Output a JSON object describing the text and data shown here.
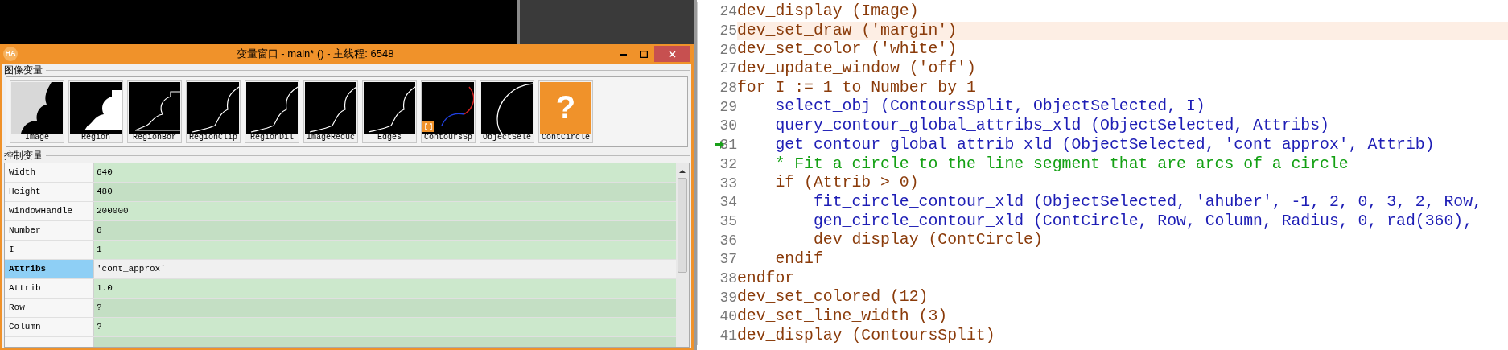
{
  "variable_window": {
    "logo": "HA",
    "title": "变量窗口 - main* () - 主线程: 6548",
    "iconic_section": "图像变量",
    "iconic_vars": [
      {
        "name": "Image",
        "kind": "gray",
        "tuple": false
      },
      {
        "name": "Region",
        "kind": "region",
        "tuple": false
      },
      {
        "name": "RegionBor",
        "kind": "border",
        "tuple": false
      },
      {
        "name": "RegionClip",
        "kind": "contour",
        "tuple": false
      },
      {
        "name": "RegionDil",
        "kind": "contour",
        "tuple": false
      },
      {
        "name": "ImageReduc",
        "kind": "contour",
        "tuple": false
      },
      {
        "name": "Edges",
        "kind": "contour",
        "tuple": false
      },
      {
        "name": "ContoursSp",
        "kind": "split",
        "tuple": true
      },
      {
        "name": "ObjectSele",
        "kind": "circle",
        "tuple": false
      },
      {
        "name": "ContCircle",
        "kind": "undefined",
        "glyph": "?",
        "tuple": false
      }
    ],
    "control_section": "控制变量",
    "control_vars": [
      {
        "name": "Width",
        "value": "640",
        "selected": false
      },
      {
        "name": "Height",
        "value": "480",
        "selected": false
      },
      {
        "name": "WindowHandle",
        "value": "200000",
        "selected": false
      },
      {
        "name": "Number",
        "value": "6",
        "selected": false
      },
      {
        "name": "I",
        "value": "1",
        "selected": false
      },
      {
        "name": "Attribs",
        "value": "'cont_approx'",
        "selected": true
      },
      {
        "name": "Attrib",
        "value": "1.0",
        "selected": false
      },
      {
        "name": "Row",
        "value": "?",
        "selected": false
      },
      {
        "name": "Column",
        "value": "?",
        "selected": false
      }
    ]
  },
  "editor": {
    "lines": [
      {
        "number": "24",
        "text": "dev_display (Image)",
        "kind": "control",
        "highlighted": false,
        "current": false
      },
      {
        "number": "25",
        "text": "dev_set_draw ('margin')",
        "kind": "control",
        "highlighted": true,
        "current": false
      },
      {
        "number": "26",
        "text": "dev_set_color ('white')",
        "kind": "control",
        "highlighted": false,
        "current": false
      },
      {
        "number": "27",
        "text": "dev_update_window ('off')",
        "kind": "control",
        "highlighted": false,
        "current": false
      },
      {
        "number": "28",
        "text": "for I := 1 to Number by 1",
        "kind": "control",
        "highlighted": false,
        "current": false
      },
      {
        "number": "29",
        "text": "    select_obj (ContoursSplit, ObjectSelected, I)",
        "kind": "operator",
        "highlighted": false,
        "current": false
      },
      {
        "number": "30",
        "text": "    query_contour_global_attribs_xld (ObjectSelected, Attribs)",
        "kind": "operator",
        "highlighted": false,
        "current": false
      },
      {
        "number": "31",
        "text": "    get_contour_global_attrib_xld (ObjectSelected, 'cont_approx', Attrib)",
        "kind": "operator",
        "highlighted": false,
        "current": true
      },
      {
        "number": "32",
        "text": "    * Fit a circle to the line segment that are arcs of a circle",
        "kind": "comment",
        "highlighted": false,
        "current": false
      },
      {
        "number": "33",
        "text": "    if (Attrib > 0)",
        "kind": "control",
        "highlighted": false,
        "current": false
      },
      {
        "number": "34",
        "text": "        fit_circle_contour_xld (ObjectSelected, 'ahuber', -1, 2, 0, 3, 2, Row,",
        "kind": "operator",
        "highlighted": false,
        "current": false
      },
      {
        "number": "35",
        "text": "        gen_circle_contour_xld (ContCircle, Row, Column, Radius, 0, rad(360),",
        "kind": "operator",
        "highlighted": false,
        "current": false
      },
      {
        "number": "36",
        "text": "        dev_display (ContCircle)",
        "kind": "control",
        "highlighted": false,
        "current": false
      },
      {
        "number": "37",
        "text": "    endif",
        "kind": "control",
        "highlighted": false,
        "current": false
      },
      {
        "number": "38",
        "text": "endfor",
        "kind": "control",
        "highlighted": false,
        "current": false
      },
      {
        "number": "39",
        "text": "dev_set_colored (12)",
        "kind": "control",
        "highlighted": false,
        "current": false
      },
      {
        "number": "40",
        "text": "dev_set_line_width (3)",
        "kind": "control",
        "highlighted": false,
        "current": false
      },
      {
        "number": "41",
        "text": "dev_display (ContoursSplit)",
        "kind": "control",
        "highlighted": false,
        "current": false
      }
    ]
  }
}
